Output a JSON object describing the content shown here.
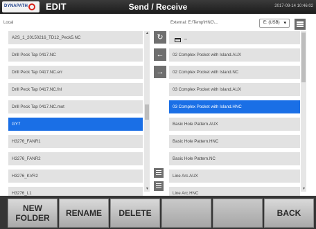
{
  "header": {
    "logo_text": "DYNAPATH",
    "mode": "EDIT",
    "title": "Send / Receive",
    "datetime": "2017-09-14 10:46:02"
  },
  "local": {
    "label": "Local",
    "items": [
      "A2S_1_20150216_TD12_Peck5.NC",
      "Drill Peck Tap 0417.NC",
      "Drill Peck Tap 0417.NC.err",
      "Drill Peck Tap 0417.NC.fnl",
      "Drill Peck Tap 0417.NC.mot",
      "GY7",
      "H3276_FANR1",
      "H3276_FANR2",
      "H3276_KVR2",
      "H3276_L1"
    ],
    "selected_index": 5
  },
  "external": {
    "label": "External: E:\\Temp\\HNC\\...",
    "drive_value": "E: (USB)",
    "parent_dot": "_",
    "items": [
      "02 Complex Pocket with Island.AUX",
      "02 Complex Pocket with Island.NC",
      "03 Complex Pocket with Island.AUX",
      "03 Complex Pocket with Island.HNC",
      "Basic Hole Pattern.AUX",
      "Basic Hole Pattern.HNC",
      "Basic Hole Pattern.NC",
      "Line Arc.AUX",
      "Line Arc.HNC"
    ],
    "selected_index": 3
  },
  "icons": {
    "refresh": "refresh-icon",
    "send_left": "arrow-left-icon",
    "send_right": "arrow-right-icon",
    "sort": "sort-icon",
    "menu": "menu-icon",
    "folder": "folder-icon"
  },
  "softkeys": {
    "new_folder": "NEW\nFOLDER",
    "rename": "RENAME",
    "delete": "DELETE",
    "back": "BACK"
  },
  "colors": {
    "selection": "#1a6fe6",
    "row_bg": "#e2e2e2",
    "logo_red": "#d8231c"
  }
}
